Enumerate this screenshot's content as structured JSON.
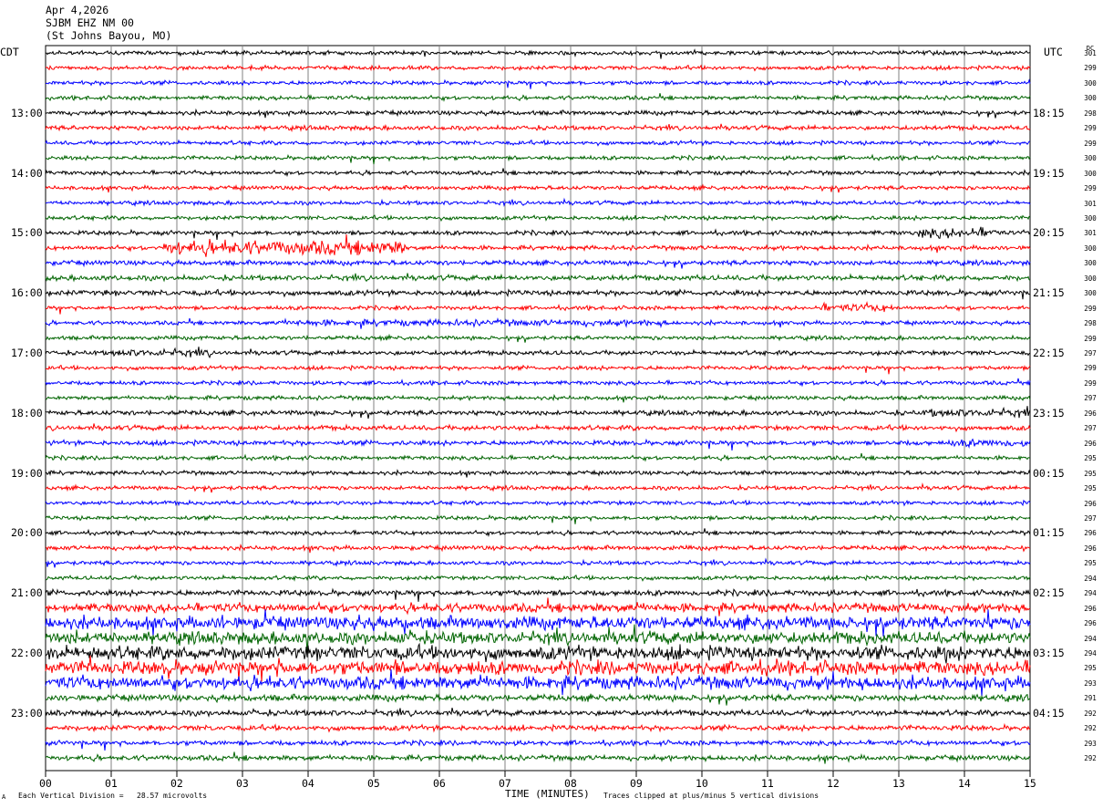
{
  "header": {
    "date": "Apr 4,2026",
    "station": "SJBM EHZ NM 00",
    "location": "(St Johns Bayou, MO)"
  },
  "left_axis_label": "CDT",
  "right_axis_label": "UTC",
  "dc_header": "DC",
  "footer": {
    "corner_mark": "A",
    "scale_note": "Each Vertical Division =   28.57 microvolts",
    "xlabel": "TIME (MINUTES)",
    "clip_note": "Traces clipped at plus/minus 5 vertical divisions"
  },
  "colors": {
    "cycle": [
      "#000000",
      "#ff0000",
      "#0000ff",
      "#006400"
    ],
    "grid": "#808080"
  },
  "chart_data": {
    "type": "line",
    "title": "SJBM EHZ NM 00",
    "xlabel": "TIME (MINUTES)",
    "xlim": [
      0,
      15
    ],
    "x_ticks": [
      "00",
      "01",
      "02",
      "03",
      "04",
      "05",
      "06",
      "07",
      "08",
      "09",
      "10",
      "11",
      "12",
      "13",
      "14",
      "15"
    ],
    "left_hour_labels": [
      "13:00",
      "14:00",
      "15:00",
      "16:00",
      "17:00",
      "18:00",
      "19:00",
      "20:00",
      "21:00",
      "22:00",
      "23:00"
    ],
    "right_hour_labels": [
      "18:15",
      "19:15",
      "20:15",
      "21:15",
      "22:15",
      "23:15",
      "00:15",
      "01:15",
      "02:15",
      "03:15",
      "04:15"
    ],
    "hour_label_first_row": 4,
    "rows_per_hour": 4,
    "dc_values": [
      "301",
      "299",
      "300",
      "300",
      "298",
      "299",
      "299",
      "300",
      "300",
      "299",
      "301",
      "300",
      "301",
      "300",
      "300",
      "300",
      "300",
      "299",
      "298",
      "299",
      "297",
      "299",
      "299",
      "297",
      "296",
      "297",
      "296",
      "295",
      "295",
      "295",
      "296",
      "297",
      "296",
      "296",
      "295",
      "294",
      "294",
      "296",
      "296",
      "294",
      "294",
      "295",
      "293",
      "291",
      "292",
      "292",
      "293",
      "292"
    ],
    "amplitude": [
      1,
      1,
      1,
      1,
      1.1,
      1.1,
      1,
      1,
      1,
      1,
      1,
      1,
      1.1,
      1.1,
      1.2,
      1.3,
      1.3,
      1,
      1,
      1,
      1.1,
      1,
      1,
      1,
      1.2,
      1.2,
      1.2,
      1,
      1,
      1,
      1,
      1,
      1,
      1.1,
      1,
      1,
      1.4,
      2.2,
      3.2,
      3,
      3.4,
      3.4,
      3.2,
      1.6,
      1.4,
      1.3,
      1.2,
      1.3
    ],
    "events": [
      {
        "row": 13,
        "start_min": 1.8,
        "end_min": 5.5,
        "level": 3.5
      },
      {
        "row": 12,
        "start_min": 13.3,
        "end_min": 14.5,
        "level": 2.5
      },
      {
        "row": 20,
        "start_min": 1.0,
        "end_min": 2.5,
        "level": 1.8
      },
      {
        "row": 17,
        "start_min": 11.8,
        "end_min": 12.9,
        "level": 2.0
      },
      {
        "row": 24,
        "start_min": 13.4,
        "end_min": 15.0,
        "level": 2.0
      },
      {
        "row": 26,
        "start_min": 13.8,
        "end_min": 15.0,
        "level": 2.0
      },
      {
        "row": 18,
        "start_min": 3.5,
        "end_min": 9.5,
        "level": 1.6
      }
    ]
  }
}
